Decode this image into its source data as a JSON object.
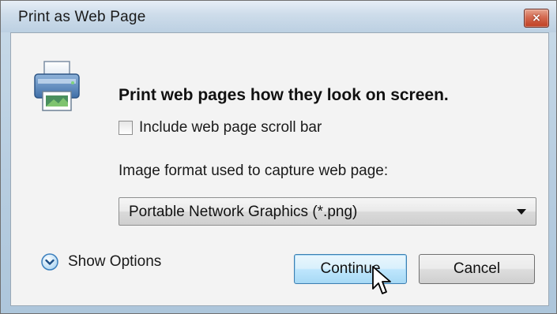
{
  "window": {
    "title": "Print as Web Page",
    "close_glyph": "×"
  },
  "dialog": {
    "icon": "printer-icon",
    "instruction": "Print web pages how they look on screen.",
    "scrollbar_checkbox": {
      "label": "Include web page scroll bar",
      "checked": false
    },
    "format_label": "Image format used to capture web page:",
    "format_select": {
      "selected": "Portable Network Graphics (*.png)"
    },
    "show_options": {
      "label": "Show Options",
      "icon": "chevron-down-circle-icon"
    },
    "buttons": {
      "continue": "Continue",
      "cancel": "Cancel"
    }
  },
  "colors": {
    "title_bar": "#cddcea",
    "client_bg": "#f3f3f3",
    "default_button": "#bee6fd",
    "close_button": "#d46a50"
  }
}
